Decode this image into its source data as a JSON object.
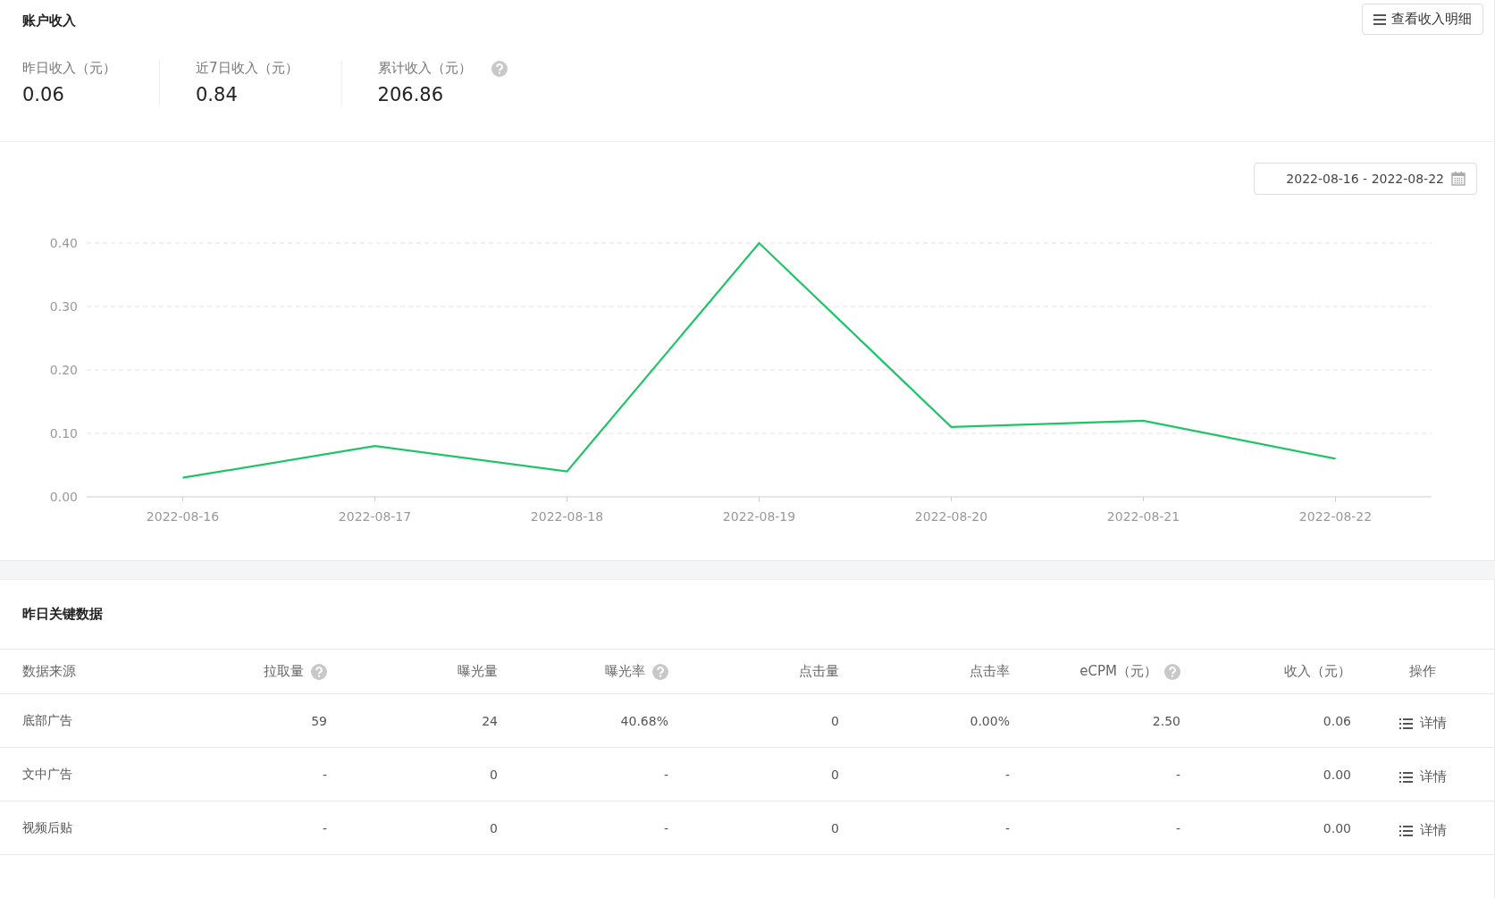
{
  "income_card": {
    "title": "账户收入",
    "detail_button": "查看收入明细",
    "stats": [
      {
        "label": "昨日收入（元）",
        "value": "0.06",
        "help": false
      },
      {
        "label": "近7日收入（元）",
        "value": "0.84",
        "help": false
      },
      {
        "label": "累计收入（元）",
        "value": "206.86",
        "help": true
      }
    ]
  },
  "chart_card": {
    "date_range": "2022-08-16 - 2022-08-22",
    "chart_data": {
      "type": "line",
      "categories": [
        "2022-08-16",
        "2022-08-17",
        "2022-08-18",
        "2022-08-19",
        "2022-08-20",
        "2022-08-21",
        "2022-08-22"
      ],
      "grid": true,
      "series": [
        {
          "color": "#1ec467",
          "values": [
            0.03,
            0.08,
            0.04,
            0.4,
            0.11,
            0.12,
            0.06
          ]
        }
      ],
      "ylim": [
        0,
        0.4
      ],
      "yticks": [
        {
          "value": 0,
          "label": "0.00"
        },
        {
          "value": 0.1,
          "label": "0.10"
        },
        {
          "value": 0.2,
          "label": "0.20"
        },
        {
          "value": 0.3,
          "label": "0.30"
        },
        {
          "value": 0.4,
          "label": "0.40"
        }
      ]
    }
  },
  "key_data": {
    "title": "昨日关键数据",
    "table": {
      "columns": [
        {
          "label": "数据来源",
          "help": false
        },
        {
          "label": "拉取量",
          "help": true
        },
        {
          "label": "曝光量",
          "help": false
        },
        {
          "label": "曝光率",
          "help": true
        },
        {
          "label": "点击量",
          "help": false
        },
        {
          "label": "点击率",
          "help": false
        },
        {
          "label": "eCPM（元）",
          "help": true
        },
        {
          "label": "收入（元）",
          "help": false
        },
        {
          "label": "操作",
          "help": false
        }
      ],
      "rows": [
        {
          "cells": [
            "底部广告",
            "59",
            "24",
            "40.68%",
            "0",
            "0.00%",
            "2.50",
            "0.06"
          ],
          "action": "详情"
        },
        {
          "cells": [
            "文中广告",
            "-",
            "0",
            "-",
            "0",
            "-",
            "-",
            "0.00"
          ],
          "action": "详情"
        },
        {
          "cells": [
            "视频后贴",
            "-",
            "0",
            "-",
            "0",
            "-",
            "-",
            "0.00"
          ],
          "action": "详情"
        }
      ]
    }
  }
}
